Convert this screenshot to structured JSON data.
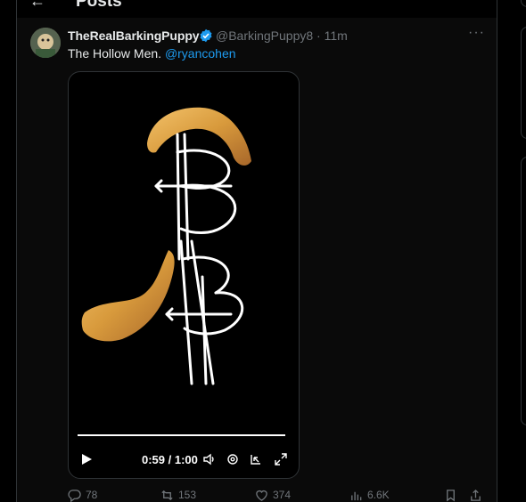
{
  "header": {
    "title": "Posts"
  },
  "tweet": {
    "display_name": "TheRealBarkingPuppy",
    "handle_time": "@BarkingPuppy8 · 11m",
    "text": "The Hollow Men.",
    "mention": "@ryancohen"
  },
  "video": {
    "time": "0:59 / 1:00",
    "progress": 0.98
  },
  "actions": {
    "replies": "78",
    "reposts": "153",
    "likes": "374",
    "views": "6.6K"
  },
  "colors": {
    "accent": "#1d9bf0",
    "muted": "#71767b",
    "text": "#e7e9ea"
  }
}
